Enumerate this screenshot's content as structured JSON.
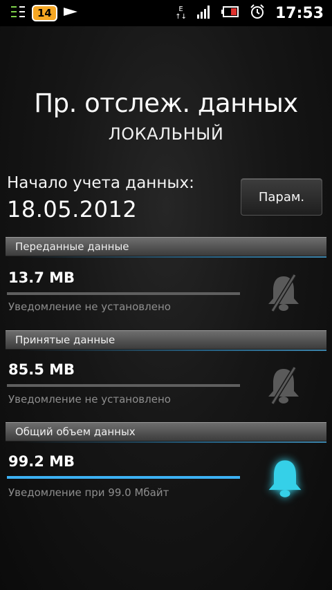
{
  "status_bar": {
    "badge": "14",
    "network_label": "E",
    "time": "17:53",
    "icons": [
      "usb-debug-icon",
      "notification-count-badge",
      "play-icon",
      "edge-data-icon",
      "signal-icon",
      "battery-icon",
      "alarm-icon"
    ]
  },
  "header": {
    "title": "Пр. отслеж. данных",
    "subtitle": "ЛОКАЛЬНЫЙ"
  },
  "start": {
    "label": "Начало учета данных:",
    "date": "18.05.2012",
    "params_button": "Парам."
  },
  "sections": [
    {
      "header": "Переданные данные",
      "amount": "13.7 MB",
      "progress": 0,
      "note": "Уведомление не установлено",
      "alert_state": "off"
    },
    {
      "header": "Принятые данные",
      "amount": "85.5 MB",
      "progress": 0,
      "note": "Уведомление не установлено",
      "alert_state": "off"
    },
    {
      "header": "Общий объем данных",
      "amount": "99.2 MB",
      "progress": 1.0,
      "note": "Уведомление при 99.0 Мбайт",
      "alert_state": "on"
    }
  ],
  "colors": {
    "accent": "#3cb1f3",
    "bell_active": "#35d0e8",
    "bell_inactive": "#5a5a5a"
  }
}
